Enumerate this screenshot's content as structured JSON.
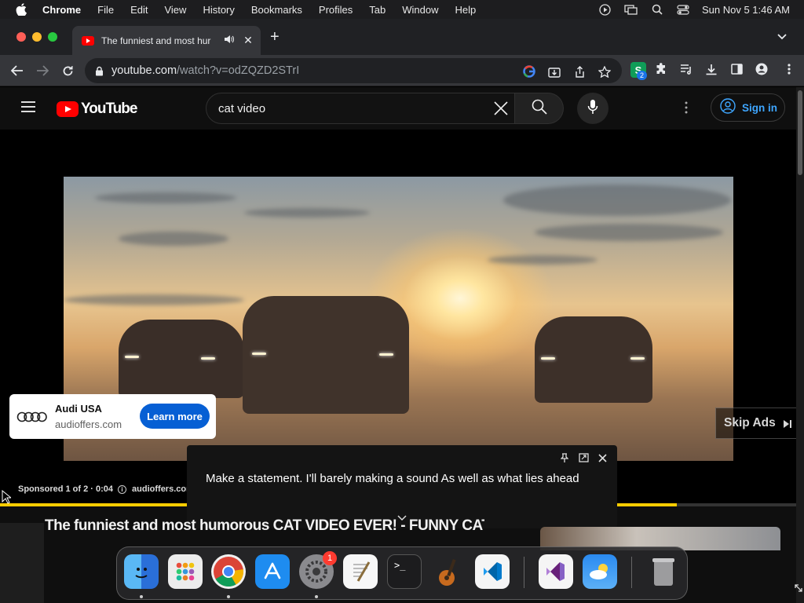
{
  "menubar": {
    "app": "Chrome",
    "items": [
      "File",
      "Edit",
      "View",
      "History",
      "Bookmarks",
      "Profiles",
      "Tab",
      "Window",
      "Help"
    ],
    "clock": "Sun Nov 5  1:46 AM"
  },
  "tab": {
    "title": "The funniest and most hur"
  },
  "toolbar": {
    "url_host": "youtube.com",
    "url_path": "/watch?v=odZQZD2STrI",
    "extension_badge": "2"
  },
  "youtube": {
    "logo_text": "YouTube",
    "search_query": "cat video",
    "signin_label": "Sign in"
  },
  "ad": {
    "advertiser": "Audi USA",
    "domain": "audioffers.com",
    "cta": "Learn more",
    "skip_label": "Skip Ads",
    "sponsored": "Sponsored 1 of 2 · 0:04",
    "info_domain": "audioffers.com",
    "progress_fraction": 0.85
  },
  "caption": {
    "text": "Make a statement. I'll barely making a sound As well as what lies ahead"
  },
  "video": {
    "title": "The funniest and most humorous CAT VIDEO EVER! - FUNNY CAT VIDEOS"
  },
  "dock": {
    "apps": [
      "finder-icon",
      "launchpad-icon",
      "chrome-icon",
      "app-store-icon",
      "system-settings-icon",
      "textedit-icon",
      "terminal-icon",
      "garageband-icon",
      "vscode-icon",
      "visual-studio-icon",
      "weather-icon",
      "trash-icon"
    ],
    "settings_badge": "1"
  },
  "colors": {
    "youtube_red": "#ff0000",
    "link_blue": "#3ea6ff",
    "cta_blue": "#065fd4",
    "ad_progress": "#ffcc00"
  }
}
